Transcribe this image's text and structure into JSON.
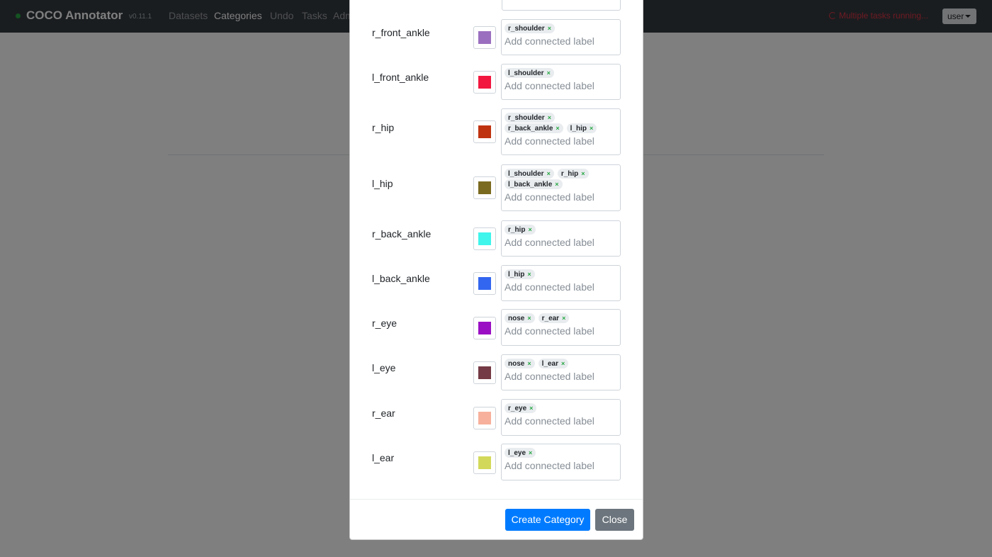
{
  "navbar": {
    "brand": "COCO Annotator",
    "version": "v0.11.1",
    "links": [
      "Datasets",
      "Categories",
      "Undo",
      "Tasks",
      "Adm"
    ],
    "tasks_status": "Multiple tasks running...",
    "user_label": "user"
  },
  "modal": {
    "placeholder": "Add connected label",
    "keypoints": [
      {
        "name": "r_front_ankle",
        "color": "#9b6fc0",
        "connections": [
          "r_shoulder"
        ]
      },
      {
        "name": "l_front_ankle",
        "color": "#f2173f",
        "connections": [
          "l_shoulder"
        ]
      },
      {
        "name": "r_hip",
        "color": "#bf3310",
        "connections": [
          "r_shoulder",
          "r_back_ankle",
          "l_hip"
        ]
      },
      {
        "name": "l_hip",
        "color": "#7a6a1f",
        "connections": [
          "l_shoulder",
          "r_hip",
          "l_back_ankle"
        ]
      },
      {
        "name": "r_back_ankle",
        "color": "#3ff5ec",
        "connections": [
          "r_hip"
        ]
      },
      {
        "name": "l_back_ankle",
        "color": "#3366f0",
        "connections": [
          "l_hip"
        ]
      },
      {
        "name": "r_eye",
        "color": "#9a0fc4",
        "connections": [
          "nose",
          "r_ear"
        ]
      },
      {
        "name": "l_eye",
        "color": "#743a45",
        "connections": [
          "nose",
          "l_ear"
        ]
      },
      {
        "name": "r_ear",
        "color": "#f7b09b",
        "connections": [
          "r_eye"
        ]
      },
      {
        "name": "l_ear",
        "color": "#d2d95a",
        "connections": [
          "l_eye"
        ]
      }
    ],
    "create_button": "Create Category",
    "close_button": "Close"
  }
}
